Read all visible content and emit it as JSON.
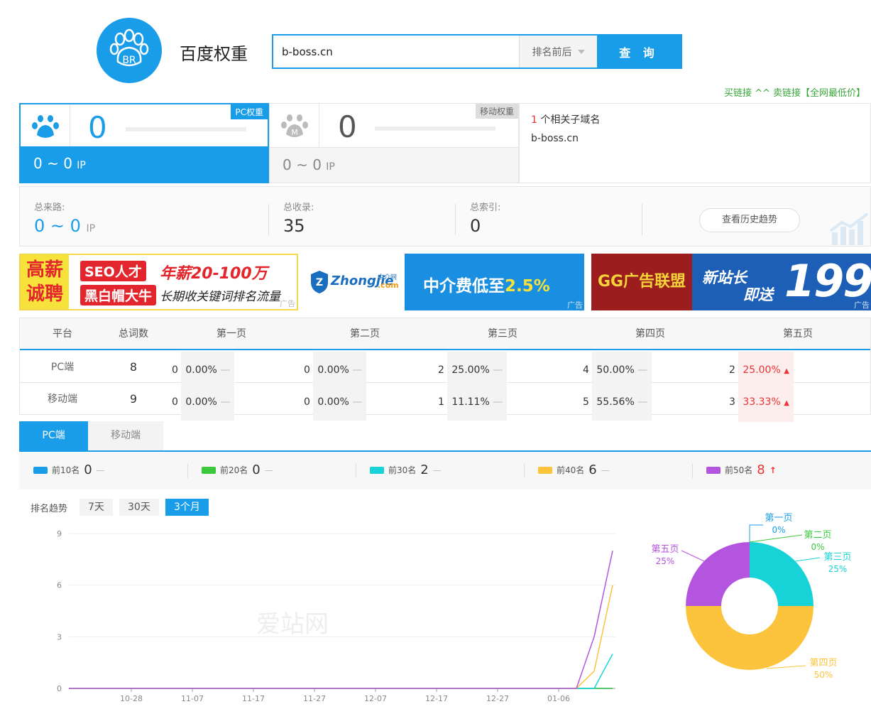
{
  "brand": {
    "title": "百度权重",
    "logo_text": "BR"
  },
  "search": {
    "value": "b-boss.cn",
    "select": "排名前后",
    "button": "查 询"
  },
  "buylink": "买链接 ^^ 卖链接【全网最低价】",
  "pc": {
    "tag": "PC权重",
    "value": "0",
    "ip": "0 ~ 0",
    "ip_unit": "IP"
  },
  "mobile": {
    "tag": "移动权重",
    "value": "0",
    "ip": "0 ~ 0",
    "ip_unit": "IP",
    "icon_letter": "M"
  },
  "subdomain": {
    "count": "1",
    "label": "个相关子域名",
    "domain": "b-boss.cn"
  },
  "stats": {
    "traffic_label": "总来路:",
    "traffic": "0 ~ 0",
    "traffic_unit": "IP",
    "indexed_label": "总收录:",
    "indexed": "35",
    "index_label": "总索引:",
    "index": "0",
    "history_btn": "查看历史趋势"
  },
  "ads": {
    "ad1": {
      "l1": "高薪",
      "l2": "诚聘",
      "seo": "SEO人才",
      "salary": "年薪20-100万",
      "bh": "黑白帽大牛",
      "desc": "长期收关键词排名流量",
      "tag": "广告"
    },
    "ad2": {
      "logo": "Zhongjie",
      "sub": "中介网",
      "dotcom": ".com",
      "text": "中介费低至",
      "pct": "2.5%",
      "tag": "广告"
    },
    "ad3": {
      "gg": "GG广告联盟",
      "t1": "新站长",
      "t2": "即送",
      "num": "199",
      "tag": "广告"
    }
  },
  "table": {
    "headers": [
      "平台",
      "总词数",
      "第一页",
      "第二页",
      "第三页",
      "第四页",
      "第五页"
    ],
    "rows": [
      {
        "platform": "PC端",
        "total": "8",
        "pages": [
          {
            "n": "0",
            "p": "0.00%",
            "t": "—"
          },
          {
            "n": "0",
            "p": "0.00%",
            "t": "—"
          },
          {
            "n": "2",
            "p": "25.00%",
            "t": "—"
          },
          {
            "n": "4",
            "p": "50.00%",
            "t": "—"
          },
          {
            "n": "2",
            "p": "25.00%",
            "t": "▲"
          }
        ]
      },
      {
        "platform": "移动端",
        "total": "9",
        "pages": [
          {
            "n": "0",
            "p": "0.00%",
            "t": "—"
          },
          {
            "n": "0",
            "p": "0.00%",
            "t": "—"
          },
          {
            "n": "1",
            "p": "11.11%",
            "t": "—"
          },
          {
            "n": "5",
            "p": "55.56%",
            "t": "—"
          },
          {
            "n": "3",
            "p": "33.33%",
            "t": "▲"
          }
        ]
      }
    ]
  },
  "tabs": [
    "PC端",
    "移动端"
  ],
  "legend": [
    {
      "label": "前10名",
      "value": "0",
      "trend": "—",
      "color": "#1a9de8"
    },
    {
      "label": "前20名",
      "value": "0",
      "trend": "—",
      "color": "#3cc83c"
    },
    {
      "label": "前30名",
      "value": "2",
      "trend": "—",
      "color": "#17d3d8"
    },
    {
      "label": "前40名",
      "value": "6",
      "trend": "—",
      "color": "#fcc33c"
    },
    {
      "label": "前50名",
      "value": "8",
      "trend": "↑",
      "color": "#b455e0"
    }
  ],
  "trend": {
    "label": "排名趋势",
    "ranges": [
      "7天",
      "30天",
      "3个月"
    ],
    "watermark": "爱站网"
  },
  "chart_data": [
    {
      "type": "line",
      "x": [
        "10-28",
        "11-07",
        "11-17",
        "11-27",
        "12-07",
        "12-17",
        "12-27",
        "01-06"
      ],
      "ylim": [
        0,
        9
      ],
      "yticks": [
        "0",
        "3",
        "6",
        "9"
      ],
      "series": [
        {
          "name": "前10名",
          "color": "#1a9de8",
          "values": [
            0,
            0,
            0,
            0,
            0,
            0,
            0,
            0,
            0,
            0
          ]
        },
        {
          "name": "前20名",
          "color": "#3cc83c",
          "values": [
            0,
            0,
            0,
            0,
            0,
            0,
            0,
            0,
            0,
            0
          ]
        },
        {
          "name": "前30名",
          "color": "#17d3d8",
          "values": [
            0,
            0,
            0,
            0,
            0,
            0,
            0,
            0,
            0,
            2
          ]
        },
        {
          "name": "前40名",
          "color": "#fcc33c",
          "values": [
            0,
            0,
            0,
            0,
            0,
            0,
            0,
            0,
            1,
            6
          ]
        },
        {
          "name": "前50名",
          "color": "#b455e0",
          "values": [
            0,
            0,
            0,
            0,
            0,
            0,
            0,
            0,
            3,
            8
          ]
        }
      ]
    },
    {
      "type": "pie",
      "slices": [
        {
          "label": "第一页",
          "value": 0,
          "pct": "0%",
          "color": "#1a9de8"
        },
        {
          "label": "第二页",
          "value": 0,
          "pct": "0%",
          "color": "#3cc83c"
        },
        {
          "label": "第三页",
          "value": 25,
          "pct": "25%",
          "color": "#17d3d8"
        },
        {
          "label": "第四页",
          "value": 50,
          "pct": "50%",
          "color": "#fcc33c"
        },
        {
          "label": "第五页",
          "value": 25,
          "pct": "25%",
          "color": "#b455e0"
        }
      ]
    }
  ]
}
